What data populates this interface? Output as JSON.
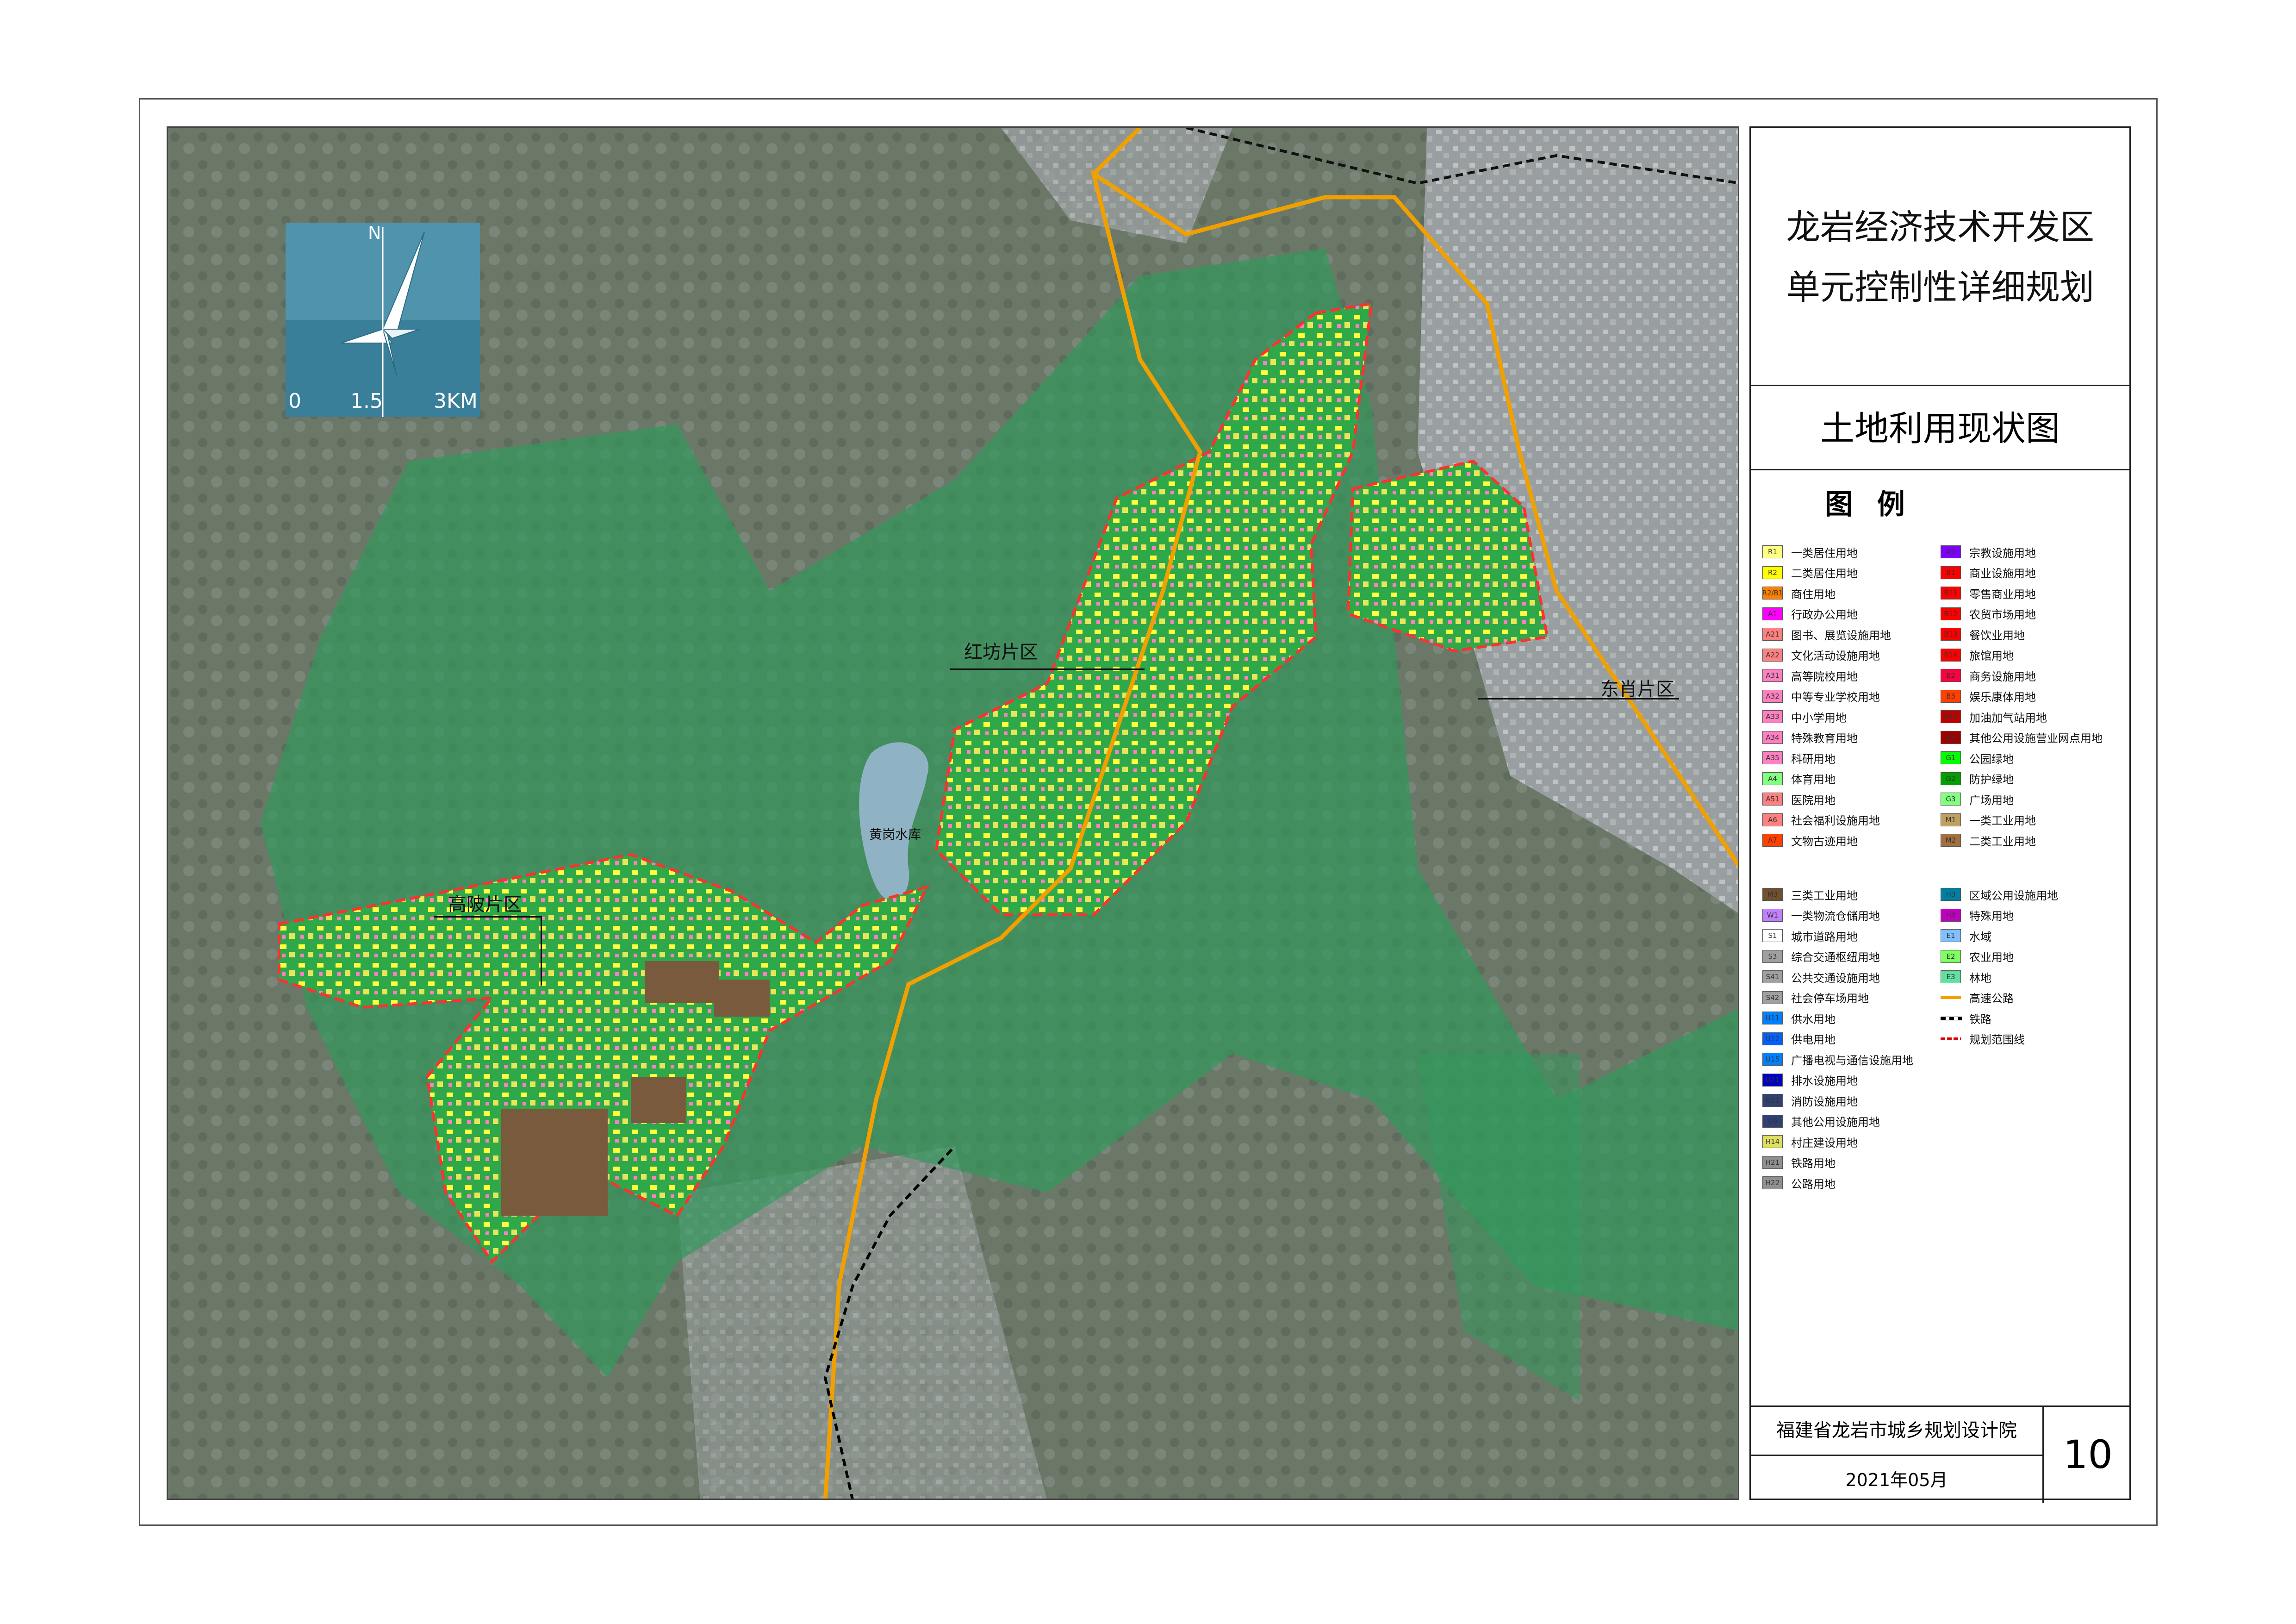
{
  "title_line1": "龙岩经济技术开发区",
  "title_line2": "单元控制性详细规划",
  "subtitle": "土地利用现状图",
  "legend_heading": "图 例",
  "compass": {
    "north": "N",
    "scale_0": "0",
    "scale_mid": "1.5",
    "scale_end": "3KM"
  },
  "zones": {
    "hongfang": "红坊片区",
    "dongxiao": "东肖片区",
    "gaopo": "高陂片区",
    "reservoir": "黄岗水库"
  },
  "legend_left": [
    {
      "code": "R1",
      "label": "一类居住用地",
      "color": "#ffff80"
    },
    {
      "code": "R2",
      "label": "二类居住用地",
      "color": "#ffff00"
    },
    {
      "code": "R2/B1",
      "label": "商住用地",
      "color": "#ff8000"
    },
    {
      "code": "A1",
      "label": "行政办公用地",
      "color": "#ff00ff"
    },
    {
      "code": "A21",
      "label": "图书、展览设施用地",
      "color": "#ff8080"
    },
    {
      "code": "A22",
      "label": "文化活动设施用地",
      "color": "#ff8080"
    },
    {
      "code": "A31",
      "label": "高等院校用地",
      "color": "#ff80c0"
    },
    {
      "code": "A32",
      "label": "中等专业学校用地",
      "color": "#ff80c0"
    },
    {
      "code": "A33",
      "label": "中小学用地",
      "color": "#ff80c0"
    },
    {
      "code": "A34",
      "label": "特殊教育用地",
      "color": "#ff80c0"
    },
    {
      "code": "A35",
      "label": "科研用地",
      "color": "#ff80c0"
    },
    {
      "code": "A4",
      "label": "体育用地",
      "color": "#80ff80"
    },
    {
      "code": "A51",
      "label": "医院用地",
      "color": "#ff8080"
    },
    {
      "code": "A6",
      "label": "社会福利设施用地",
      "color": "#ff8080"
    },
    {
      "code": "A7",
      "label": "文物古迹用地",
      "color": "#ff4000"
    }
  ],
  "legend_right": [
    {
      "code": "A9",
      "label": "宗教设施用地",
      "color": "#8000ff"
    },
    {
      "code": "B1",
      "label": "商业设施用地",
      "color": "#ff0000"
    },
    {
      "code": "B11",
      "label": "零售商业用地",
      "color": "#ff0000"
    },
    {
      "code": "B12",
      "label": "农贸市场用地",
      "color": "#ff0000"
    },
    {
      "code": "B13",
      "label": "餐饮业用地",
      "color": "#ff0000"
    },
    {
      "code": "B14",
      "label": "旅馆用地",
      "color": "#ff0000"
    },
    {
      "code": "B2",
      "label": "商务设施用地",
      "color": "#ff0040"
    },
    {
      "code": "B3",
      "label": "娱乐康体用地",
      "color": "#ff4000"
    },
    {
      "code": "B41",
      "label": "加油加气站用地",
      "color": "#c00000"
    },
    {
      "code": "B9",
      "label": "其他公用设施营业网点用地",
      "color": "#a00000"
    },
    {
      "code": "G1",
      "label": "公园绿地",
      "color": "#00ff00"
    },
    {
      "code": "G2",
      "label": "防护绿地",
      "color": "#00a000"
    },
    {
      "code": "G3",
      "label": "广场用地",
      "color": "#80ff80"
    },
    {
      "code": "M1",
      "label": "一类工业用地",
      "color": "#c0a060"
    },
    {
      "code": "M2",
      "label": "二类工业用地",
      "color": "#a07040"
    }
  ],
  "legend_left2": [
    {
      "code": "M3",
      "label": "三类工业用地",
      "color": "#705030"
    },
    {
      "code": "W1",
      "label": "一类物流仓储用地",
      "color": "#c080ff"
    },
    {
      "code": "S1",
      "label": "城市道路用地",
      "color": "#ffffff"
    },
    {
      "code": "S3",
      "label": "综合交通枢纽用地",
      "color": "#a0a0a0"
    },
    {
      "code": "S41",
      "label": "公共交通设施用地",
      "color": "#a0a0a0"
    },
    {
      "code": "S42",
      "label": "社会停车场用地",
      "color": "#a0a0a0"
    },
    {
      "code": "U11",
      "label": "供水用地",
      "color": "#0080ff"
    },
    {
      "code": "U12",
      "label": "供电用地",
      "color": "#0060ff"
    },
    {
      "code": "U15",
      "label": "广播电视与通信设施用地",
      "color": "#0080ff"
    },
    {
      "code": "U21",
      "label": "排水设施用地",
      "color": "#0000c0"
    },
    {
      "code": "U31",
      "label": "消防设施用地",
      "color": "#304070"
    },
    {
      "code": "U9",
      "label": "其他公用设施用地",
      "color": "#304070"
    },
    {
      "code": "H14",
      "label": "村庄建设用地",
      "color": "#e0e060"
    },
    {
      "code": "H21",
      "label": "铁路用地",
      "color": "#909090"
    },
    {
      "code": "H22",
      "label": "公路用地",
      "color": "#909090"
    }
  ],
  "legend_right2": [
    {
      "code": "H3",
      "label": "区域公用设施用地",
      "color": "#0080a0",
      "kind": "box"
    },
    {
      "code": "H4",
      "label": "特殊用地",
      "color": "#c000c0",
      "kind": "box"
    },
    {
      "code": "E1",
      "label": "水域",
      "color": "#80c0ff",
      "kind": "box"
    },
    {
      "code": "E2",
      "label": "农业用地",
      "color": "#80ff60",
      "kind": "box"
    },
    {
      "code": "E3",
      "label": "林地",
      "color": "#60e0a0",
      "kind": "box"
    },
    {
      "code": "",
      "label": "高速公路",
      "color": "#f0a000",
      "kind": "highway"
    },
    {
      "code": "",
      "label": "铁路",
      "color": "#000000",
      "kind": "rail"
    },
    {
      "code": "",
      "label": "规划范围线",
      "color": "#e00000",
      "kind": "boundary"
    }
  ],
  "footer": {
    "org": "福建省龙岩市城乡规划设计院",
    "date": "2021年05月",
    "page": "10"
  }
}
